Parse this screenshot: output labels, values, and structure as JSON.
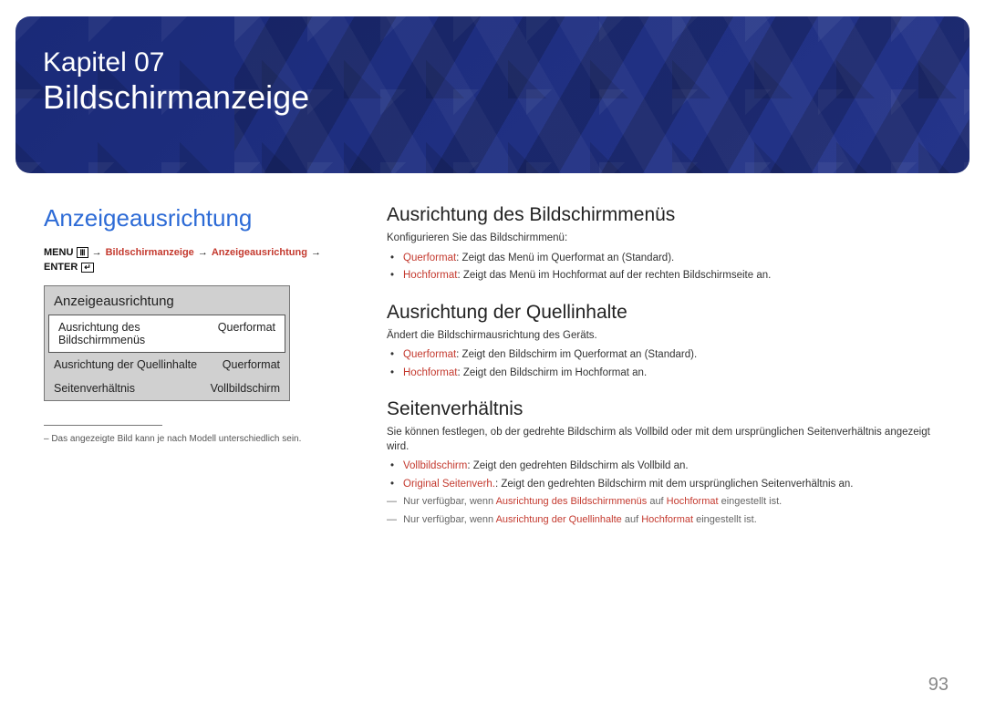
{
  "banner": {
    "kapitel": "Kapitel 07",
    "title": "Bildschirmanzeige"
  },
  "left": {
    "heading": "Anzeigeausrichtung",
    "breadcrumb": {
      "menu": "MENU",
      "path1": "Bildschirmanzeige",
      "path2": "Anzeigeausrichtung",
      "enter": "ENTER"
    },
    "panel": {
      "title": "Anzeigeausrichtung",
      "rows": [
        {
          "label": "Ausrichtung des Bildschirmmenüs",
          "value": "Querformat"
        },
        {
          "label": "Ausrichtung der Quellinhalte",
          "value": "Querformat"
        },
        {
          "label": "Seitenverhältnis",
          "value": "Vollbildschirm"
        }
      ]
    },
    "footnote": "– Das angezeigte Bild kann je nach Modell unterschiedlich sein."
  },
  "right": {
    "sections": [
      {
        "title": "Ausrichtung des Bildschirmmenüs",
        "desc": "Konfigurieren Sie das Bildschirmmenü:",
        "bullets": [
          {
            "term": "Querformat",
            "text": ": Zeigt das Menü im Querformat an (Standard)."
          },
          {
            "term": "Hochformat",
            "text": ": Zeigt das Menü im Hochformat auf der rechten Bildschirmseite an."
          }
        ]
      },
      {
        "title": "Ausrichtung der Quellinhalte",
        "desc": "Ändert die Bildschirmausrichtung des Geräts.",
        "bullets": [
          {
            "term": "Querformat",
            "text": ": Zeigt den Bildschirm im Querformat an (Standard)."
          },
          {
            "term": "Hochformat",
            "text": ": Zeigt den Bildschirm im Hochformat an."
          }
        ]
      },
      {
        "title": "Seitenverhältnis",
        "desc": "Sie können festlegen, ob der gedrehte Bildschirm als Vollbild oder mit dem ursprünglichen Seitenverhältnis angezeigt wird.",
        "bullets": [
          {
            "term": "Vollbildschirm",
            "text": ": Zeigt den gedrehten Bildschirm als Vollbild an."
          },
          {
            "term": "Original Seitenverh.",
            "text": ": Zeigt den gedrehten Bildschirm mit dem ursprünglichen Seitenverhältnis an."
          }
        ],
        "notes": [
          {
            "pre": "Nur verfügbar, wenn ",
            "t1": "Ausrichtung des Bildschirmmenüs",
            "mid": " auf ",
            "t2": "Hochformat",
            "post": " eingestellt ist."
          },
          {
            "pre": "Nur verfügbar, wenn ",
            "t1": "Ausrichtung der Quellinhalte",
            "mid": " auf ",
            "t2": "Hochformat",
            "post": " eingestellt ist."
          }
        ]
      }
    ]
  },
  "page": "93"
}
